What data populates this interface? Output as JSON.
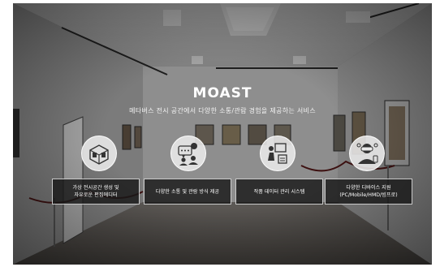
{
  "hero": {
    "title": "MOAST",
    "subtitle": "메타버스 전시 공간에서 다양한 소통/관람 경험을 제공하는 서비스"
  },
  "features": [
    {
      "icon": "3d-room-icon",
      "line1": "가상 전시공간 생성 및",
      "line2": "자유로운 편집에디터"
    },
    {
      "icon": "chat-people-icon",
      "line1": "다양한 소통 및 관람 방식 제공",
      "line2": ""
    },
    {
      "icon": "artwork-data-icon",
      "line1": "작품 데이터 관리 시스템",
      "line2": ""
    },
    {
      "icon": "vr-headset-icon",
      "line1": "다양한 디바이스 지원",
      "line2": "(PC/Mobile/HMD/빔프로)"
    }
  ],
  "colors": {
    "overlay": "#1a1a1a",
    "icon_bg": "#ebebeb",
    "text": "#ffffff"
  }
}
